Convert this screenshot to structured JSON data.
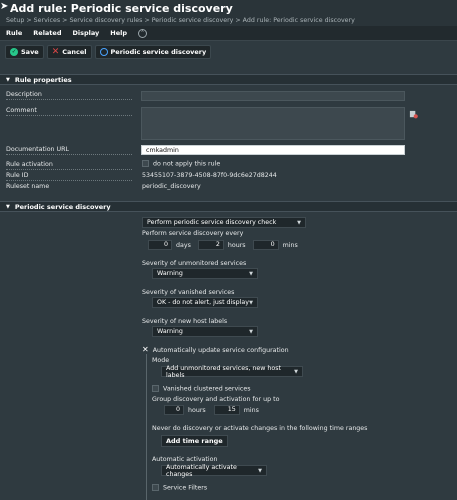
{
  "header": {
    "title": "Add rule: Periodic service discovery",
    "breadcrumb": "Setup > Services > Service discovery rules > Periodic service discovery > Add rule: Periodic service discovery"
  },
  "menu": {
    "items": [
      "Rule",
      "Related",
      "Display",
      "Help"
    ]
  },
  "toolbar": {
    "save": "Save",
    "cancel": "Cancel",
    "discovery": "Periodic service discovery"
  },
  "rule_properties": {
    "heading": "Rule properties",
    "description_label": "Description",
    "comment_label": "Comment",
    "doc_url_label": "Documentation URL",
    "doc_url_value": "cmkadmin",
    "activation_label": "Rule activation",
    "activation_text": "do not apply this rule",
    "rule_id_label": "Rule ID",
    "rule_id_value": "53455107-3879-4508-87f0-9dc6e27d8244",
    "ruleset_label": "Ruleset name",
    "ruleset_value": "periodic_discovery"
  },
  "periodic": {
    "heading": "Periodic service discovery",
    "mode_select": "Perform periodic service discovery check",
    "every_label": "Perform service discovery every",
    "days_val": "0",
    "days_unit": "days",
    "hours_val": "2",
    "hours_unit": "hours",
    "mins_val": "0",
    "mins_unit": "mins",
    "unmon_label": "Severity of unmonitored services",
    "unmon_val": "Warning",
    "vanished_label": "Severity of vanished services",
    "vanished_val": "OK - do not alert, just display",
    "labels_label": "Severity of new host labels",
    "labels_val": "Warning",
    "auto_label": "Automatically update service configuration",
    "mode_label": "Mode",
    "mode_val": "Add unmonitored services, new host labels",
    "vanished_clustered": "Vanished clustered services",
    "group_label": "Group discovery and activation for up to",
    "group_hours_val": "0",
    "group_hours_unit": "hours",
    "group_mins_val": "15",
    "group_mins_unit": "mins",
    "never_label": "Never do discovery or activate changes in the following time ranges",
    "add_time_range": "Add time range",
    "auto_activation_label": "Automatic activation",
    "auto_activation_val": "Automatically activate changes",
    "service_filters": "Service Filters"
  }
}
